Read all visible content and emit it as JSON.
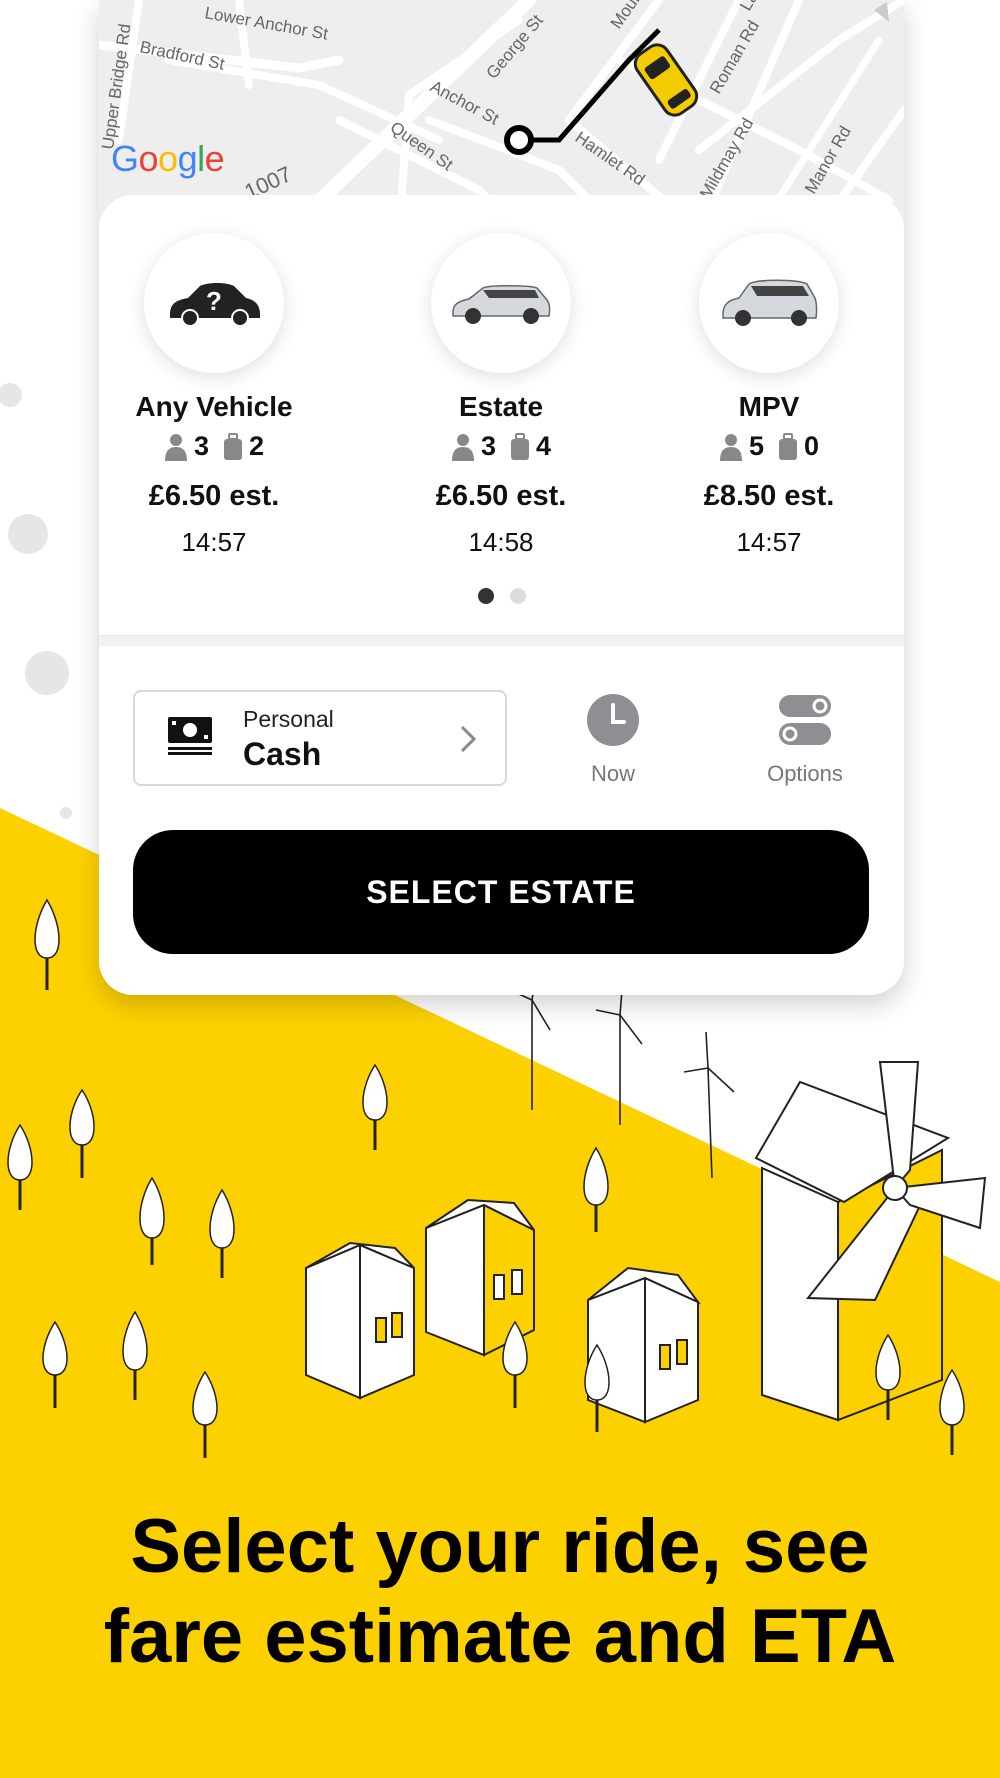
{
  "colors": {
    "brand_yellow": "#fdd100",
    "cta_background": "#000000",
    "cta_text": "#ffffff",
    "active_dot": "#333333"
  },
  "map": {
    "attribution": "Google",
    "street_labels": [
      "Lower Anchor St",
      "Bradford St",
      "Upper Bridge Rd",
      "George St",
      "Anchor St",
      "Queen St",
      "Hamlet Rd",
      "Moulsham St",
      "Roman Rd",
      "Lady Lane Rd",
      "Mildmay Rd",
      "Manor Rd",
      "1007"
    ]
  },
  "vehicles": [
    {
      "name": "Any Vehicle",
      "passengers": "3",
      "luggage": "2",
      "price": "£6.50 est.",
      "eta": "14:57",
      "icon": "unknown-car-icon"
    },
    {
      "name": "Estate",
      "passengers": "3",
      "luggage": "4",
      "price": "£6.50 est.",
      "eta": "14:58",
      "icon": "estate-car-icon"
    },
    {
      "name": "MPV",
      "passengers": "5",
      "luggage": "0",
      "price": "£8.50 est.",
      "eta": "14:57",
      "icon": "mpv-car-icon"
    }
  ],
  "carousel": {
    "page": 1,
    "pages": 2
  },
  "payment": {
    "type": "Personal",
    "method": "Cash",
    "icon": "cash-icon"
  },
  "controls": {
    "time_label": "Now",
    "options_label": "Options"
  },
  "cta": {
    "label": "SELECT ESTATE"
  },
  "tagline": {
    "line1": "Select your ride, see",
    "line2": "fare estimate and ETA"
  }
}
